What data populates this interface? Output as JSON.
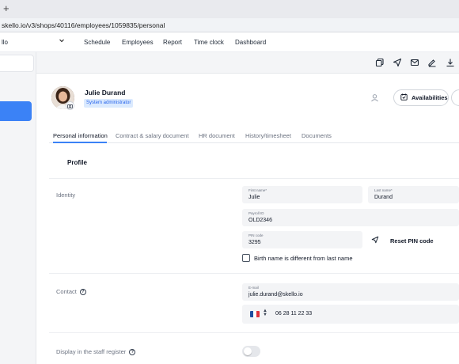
{
  "browser": {
    "new_tab_glyph": "+",
    "url": "skello.io/v3/shops/40116/employees/1059835/personal"
  },
  "nav": {
    "shop_name": "llo",
    "links": [
      "Schedule",
      "Employees",
      "Report",
      "Time clock",
      "Dashboard"
    ]
  },
  "toolbar": {
    "icons": [
      "copy-icon",
      "send-icon",
      "mail-icon",
      "sign-icon",
      "download-icon"
    ]
  },
  "employee": {
    "name": "Julie Durand",
    "role": "System administrator",
    "availabilities_label": "Availabilities"
  },
  "tabs": [
    {
      "label": "Personal information",
      "active": true
    },
    {
      "label": "Contract & salary document",
      "active": false
    },
    {
      "label": "HR document",
      "active": false
    },
    {
      "label": "History/timesheet",
      "active": false
    },
    {
      "label": "Documents",
      "active": false
    }
  ],
  "profile": {
    "title": "Profile",
    "identity_label": "Identity",
    "first_name": {
      "label": "First name*",
      "value": "Julie"
    },
    "last_name": {
      "label": "Last name*",
      "value": "Durand"
    },
    "payroll_id": {
      "label": "Payroll ID",
      "value": "OLD2346"
    },
    "pin_code": {
      "label": "PIN code",
      "value": "3295"
    },
    "reset_pin_label": "Reset PIN code",
    "birth_name_label": "Birth name is different from last name",
    "contact_label": "Contact",
    "email": {
      "label": "E-mail",
      "value": "julie.durand@skello.io"
    },
    "phone": {
      "value": "06 28 11 22 33",
      "flag_colors": [
        "#1f4fa0",
        "#ffffff",
        "#e0323c"
      ]
    },
    "staff_register_label": "Display in the staff register",
    "staff_register_enabled": false
  }
}
